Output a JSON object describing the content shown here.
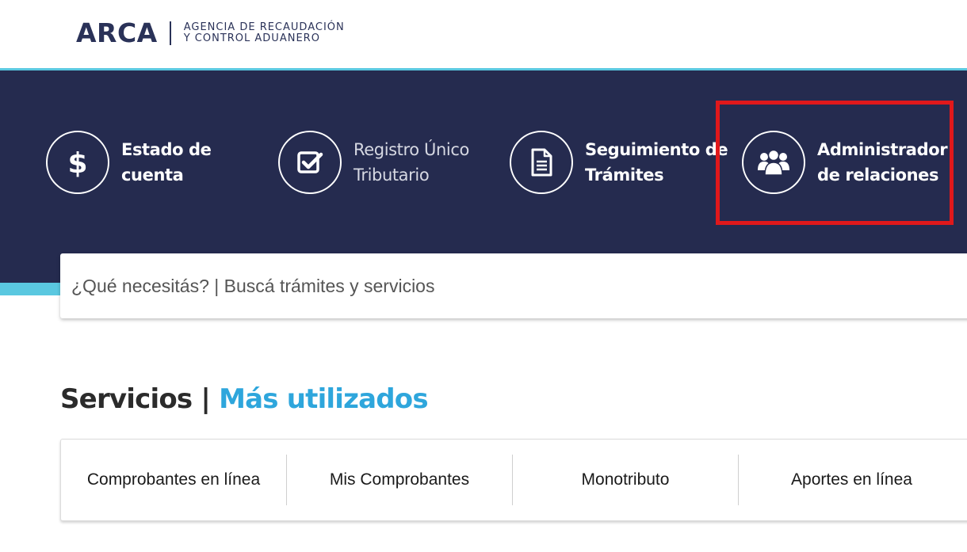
{
  "header": {
    "logo_mark": "ARCA",
    "logo_line1": "AGENCIA DE RECAUDACIÓN",
    "logo_line2": "Y CONTROL ADUANERO"
  },
  "quick_access": [
    {
      "icon": "dollar-icon",
      "line1": "Estado de",
      "line2": "cuenta"
    },
    {
      "icon": "checkbox-icon",
      "line1": "Registro Único",
      "line2": "Tributario"
    },
    {
      "icon": "document-icon",
      "line1": "Seguimiento de",
      "line2": "Trámites"
    },
    {
      "icon": "users-icon",
      "line1": "Administrador",
      "line2": "de relaciones",
      "highlighted": true
    }
  ],
  "search": {
    "placeholder": "¿Qué necesitás? | Buscá trámites y servicios"
  },
  "services_section": {
    "title": "Servicios",
    "separator": "|",
    "subtitle": "Más utilizados",
    "items": [
      "Comprobantes en línea",
      "Mis Comprobantes",
      "Monotributo",
      "Aportes en línea"
    ]
  },
  "colors": {
    "hero_bg": "#252b4f",
    "accent_cyan": "#5ac8e0",
    "highlight_red": "#e0181b",
    "subtitle_blue": "#2ea6dc",
    "logo_navy": "#2a3258"
  }
}
